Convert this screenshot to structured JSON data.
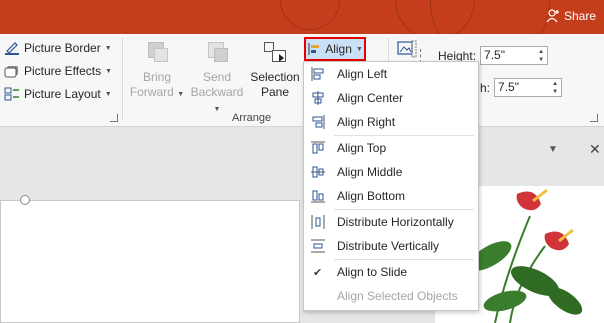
{
  "titlebar": {
    "share_label": "Share"
  },
  "picture_styles": {
    "border_label": "Picture Border",
    "effects_label": "Picture Effects",
    "layout_label": "Picture Layout"
  },
  "arrange": {
    "bring_forward_line1": "Bring",
    "bring_forward_line2": "Forward",
    "send_backward_line1": "Send",
    "send_backward_line2": "Backward",
    "selection_pane_line1": "Selection",
    "selection_pane_line2": "Pane",
    "group_label": "Arrange",
    "align_label": "Align"
  },
  "size": {
    "height_label": "Height:",
    "height_value": "7.5\"",
    "width_label": "h:",
    "width_value": "7.5\""
  },
  "align_menu": {
    "items": [
      {
        "label": "Align Left",
        "enabled": true,
        "icon": "align-left-icon"
      },
      {
        "label": "Align Center",
        "enabled": true,
        "icon": "align-center-icon"
      },
      {
        "label": "Align Right",
        "enabled": true,
        "icon": "align-right-icon"
      },
      {
        "label": "Align Top",
        "enabled": true,
        "icon": "align-top-icon"
      },
      {
        "label": "Align Middle",
        "enabled": true,
        "icon": "align-middle-icon"
      },
      {
        "label": "Align Bottom",
        "enabled": true,
        "icon": "align-bottom-icon"
      },
      {
        "label": "Distribute Horizontally",
        "enabled": true,
        "icon": "distribute-horizontally-icon"
      },
      {
        "label": "Distribute Vertically",
        "enabled": true,
        "icon": "distribute-vertically-icon"
      },
      {
        "label": "Align to Slide",
        "enabled": true,
        "checked": true
      },
      {
        "label": "Align Selected Objects",
        "enabled": false
      }
    ]
  },
  "colors": {
    "titlebar": "#c43e1c",
    "highlight_border": "#e60000",
    "button_hover": "#c9e0f7",
    "icon_blue": "#2b579a",
    "flower_red": "#d13438",
    "leaf_green": "#3a7d2c"
  }
}
